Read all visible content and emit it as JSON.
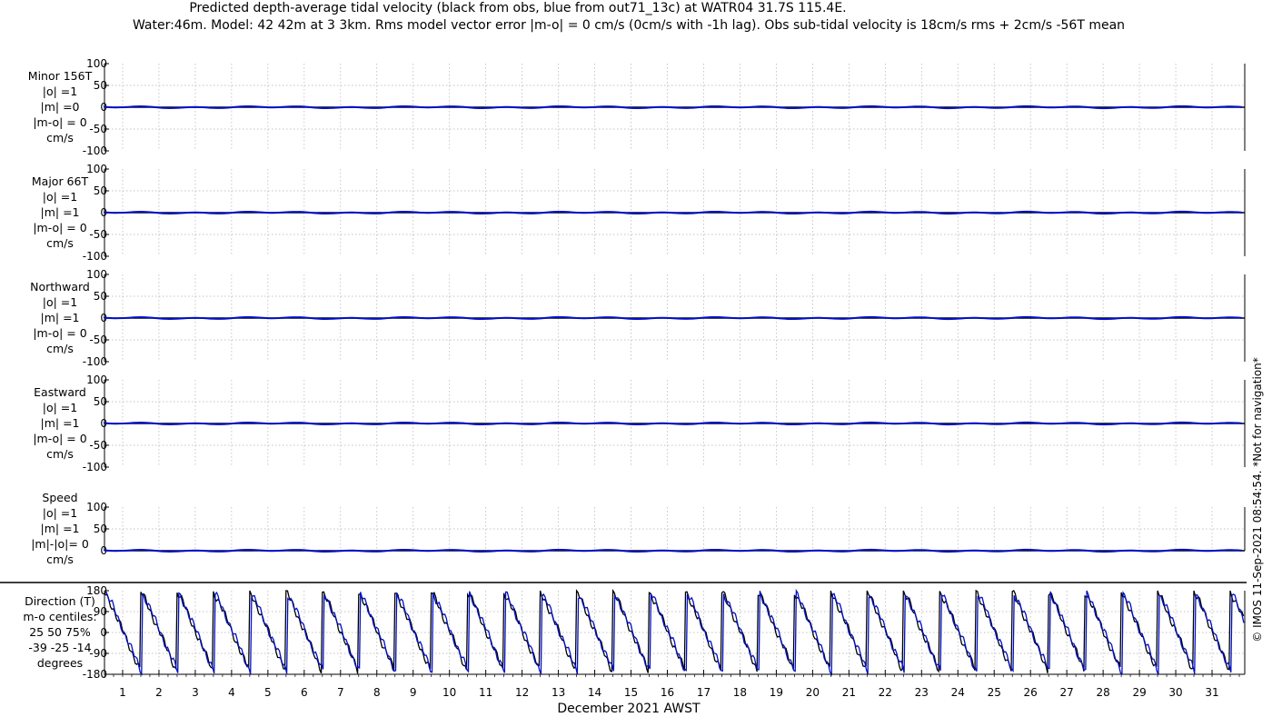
{
  "title_line1": "Predicted depth-average tidal velocity (black from obs, blue from out71_13c) at WATR04 31.7S 115.4E.",
  "title_line2": "Water:46m. Model: 42 42m at 3 3km. Rms model vector error |m-o| = 0 cm/s (0cm/s with -1h lag). Obs sub-tidal velocity is 18cm/s rms + 2cm/s -56T mean",
  "xlabel": "December 2021 AWST",
  "side_note": "© IMOS 11-Sep-2021 08:54:54. *Not for navigation*",
  "x_ticks": [
    "1",
    "2",
    "3",
    "4",
    "5",
    "6",
    "7",
    "8",
    "9",
    "10",
    "11",
    "12",
    "13",
    "14",
    "15",
    "16",
    "17",
    "18",
    "19",
    "20",
    "21",
    "22",
    "23",
    "24",
    "25",
    "26",
    "27",
    "28",
    "29",
    "30",
    "31"
  ],
  "colors": {
    "obs": "#000000",
    "model": "#0010c8"
  },
  "chart_data": [
    {
      "type": "line",
      "name": "minor",
      "label_lines": [
        "Minor 156T",
        "|o| =1",
        "|m| =0",
        "|m-o| = 0",
        "cm/s"
      ],
      "yticks": [
        "100",
        "50",
        "0",
        "-50",
        "-100"
      ],
      "ylim": [
        -100,
        100
      ],
      "xlim": [
        0.5,
        31.9
      ],
      "series_values": {
        "obs": 0,
        "model": 0
      }
    },
    {
      "type": "line",
      "name": "major",
      "label_lines": [
        "Major 66T",
        "|o| =1",
        "|m| =1",
        "|m-o| = 0",
        "cm/s"
      ],
      "yticks": [
        "100",
        "50",
        "0",
        "-50",
        "-100"
      ],
      "ylim": [
        -100,
        100
      ],
      "xlim": [
        0.5,
        31.9
      ],
      "series_values": {
        "obs": 0,
        "model": 0
      }
    },
    {
      "type": "line",
      "name": "north",
      "label_lines": [
        "Northward",
        "|o| =1",
        "|m| =1",
        "|m-o| = 0",
        "cm/s"
      ],
      "yticks": [
        "100",
        "50",
        "0",
        "-50",
        "-100"
      ],
      "ylim": [
        -100,
        100
      ],
      "xlim": [
        0.5,
        31.9
      ],
      "series_values": {
        "obs": 0,
        "model": 0
      }
    },
    {
      "type": "line",
      "name": "east",
      "label_lines": [
        "Eastward",
        "|o| =1",
        "|m| =1",
        "|m-o| = 0",
        "cm/s"
      ],
      "yticks": [
        "100",
        "50",
        "0",
        "-50",
        "-100"
      ],
      "ylim": [
        -100,
        100
      ],
      "xlim": [
        0.5,
        31.9
      ],
      "series_values": {
        "obs": 0,
        "model": 0
      }
    },
    {
      "type": "line",
      "name": "speed",
      "label_lines": [
        "Speed",
        "|o| =1",
        "|m| =1",
        "|m|-|o|= 0",
        "cm/s"
      ],
      "yticks": [
        "100",
        "50",
        "0"
      ],
      "ylim": [
        0,
        100
      ],
      "xlim": [
        0.5,
        31.9
      ],
      "series_values": {
        "obs": 0,
        "model": 0
      }
    },
    {
      "type": "line",
      "name": "direction",
      "label_lines": [
        "Direction (T)",
        "m-o centiles:",
        "25  50  75%",
        "-39 -25 -14",
        "degrees"
      ],
      "yticks": [
        "180",
        "90",
        "0",
        "-90",
        "-180"
      ],
      "ylim": [
        -180,
        180
      ],
      "xlim": [
        0.5,
        31.9
      ],
      "obs_cycle": {
        "period_days": 1.0,
        "start_day": 0.5,
        "high_deg": 175,
        "low_deg": -160
      },
      "model_cycle": {
        "period_days": 1.0,
        "start_day": 0.55,
        "high_deg": 165,
        "low_deg": -170
      }
    }
  ]
}
